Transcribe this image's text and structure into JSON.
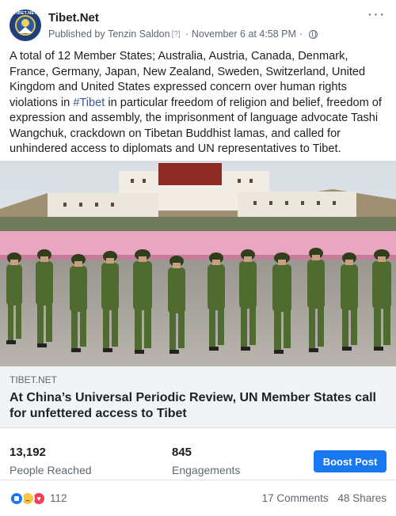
{
  "post": {
    "page_name": "Tibet.Net",
    "avatar_text": "TIBET.NET",
    "published_prefix": "Published by",
    "author": "Tenzin Saldon",
    "bracket": "[?]",
    "date": "November 6 at 4:58 PM",
    "text_before_hashtag": "A total of 12 Member States; Australia, Austria, Canada, Denmark, France, Germany, Japan, New Zealand, Sweden, Switzerland, United Kingdom and United States expressed concern over human rights violations in ",
    "hashtag": "#Tibet",
    "text_after_hashtag": " in particular freedom of religion and belief, freedom of expression and assembly, the imprisonment of language advocate Tashi Wangchuk, crackdown on Tibetan Buddhist lamas, and called for unhindered access to diplomats and UN representatives to Tibet."
  },
  "link": {
    "domain": "TIBET.NET",
    "title": "At China’s Universal Periodic Review, UN Member States call for unfettered access to Tibet"
  },
  "insights": {
    "reached_value": "13,192",
    "reached_label": "People Reached",
    "engagements_value": "845",
    "engagements_label": "Engagements",
    "boost_label": "Boost Post"
  },
  "footer": {
    "reaction_count": "112",
    "comments": "17 Comments",
    "shares": "48 Shares"
  },
  "colors": {
    "link_blue": "#385898",
    "boost_blue": "#1877f2",
    "uniform_green": "#4f6b2f"
  }
}
